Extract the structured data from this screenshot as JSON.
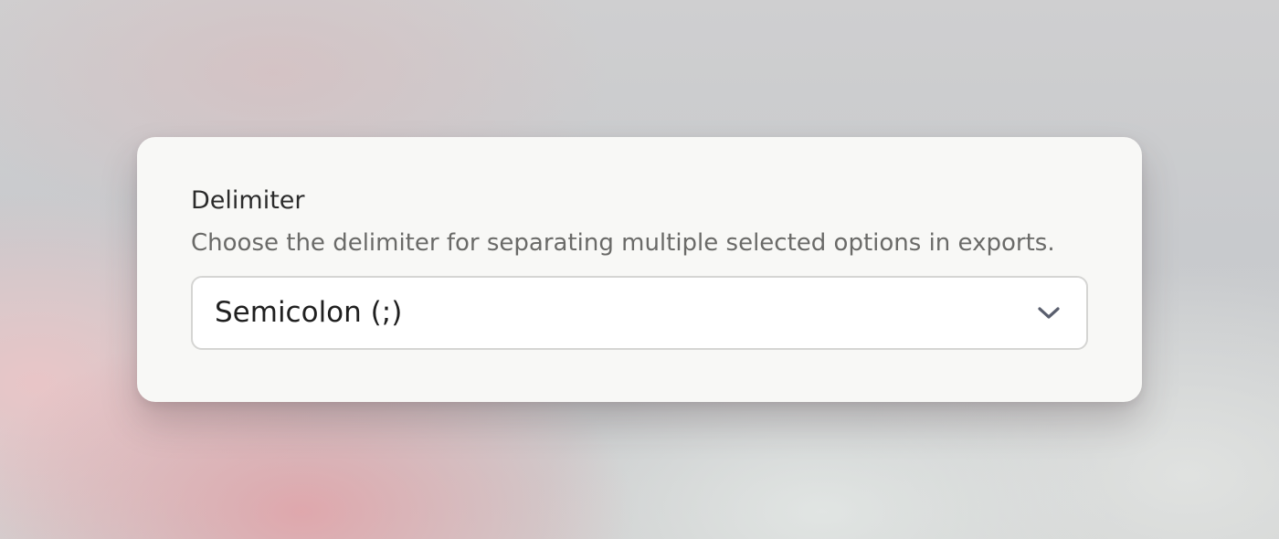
{
  "setting": {
    "label": "Delimiter",
    "description": "Choose the delimiter for separating multiple selected options in exports."
  },
  "select": {
    "selected_value": "Semicolon (;)",
    "icon": "chevron-down-icon"
  },
  "colors": {
    "card_background": "#f8f8f6",
    "label_text": "#2b2b2b",
    "description_text": "#6a6a68",
    "select_border": "#d5d5d3",
    "chevron": "#5a5f6e"
  }
}
